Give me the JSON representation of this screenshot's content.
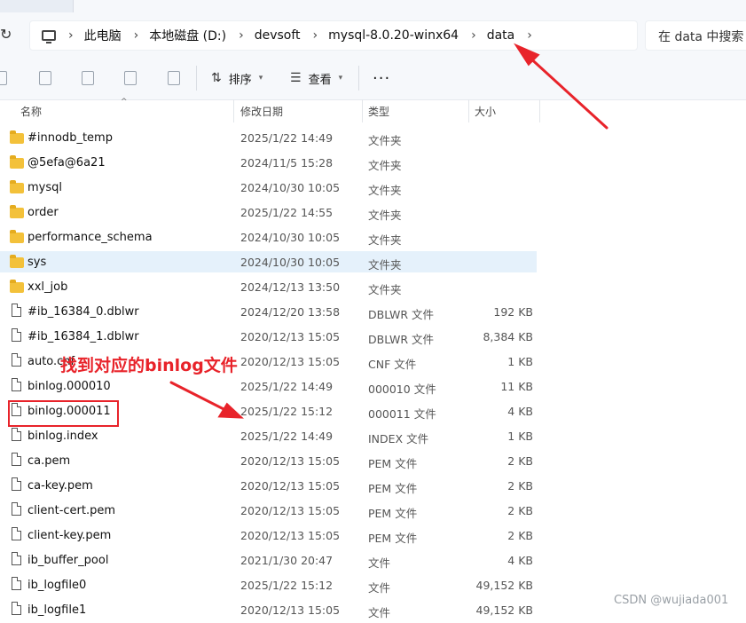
{
  "window": {
    "breadcrumb": [
      "此电脑",
      "本地磁盘 (D:)",
      "devsoft",
      "mysql-8.0.20-winx64",
      "data"
    ],
    "search_placeholder": "在 data 中搜索"
  },
  "toolbar": {
    "sort_label": "排序",
    "view_label": "查看",
    "more_label": "···"
  },
  "columns": {
    "name": "名称",
    "date": "修改日期",
    "type": "类型",
    "size": "大小"
  },
  "files": [
    {
      "name": "#innodb_temp",
      "date": "2025/1/22 14:49",
      "type": "文件夹",
      "size": "",
      "kind": "folder"
    },
    {
      "name": "@5efa@6a21",
      "date": "2024/11/5 15:28",
      "type": "文件夹",
      "size": "",
      "kind": "folder"
    },
    {
      "name": "mysql",
      "date": "2024/10/30 10:05",
      "type": "文件夹",
      "size": "",
      "kind": "folder"
    },
    {
      "name": "order",
      "date": "2025/1/22 14:55",
      "type": "文件夹",
      "size": "",
      "kind": "folder"
    },
    {
      "name": "performance_schema",
      "date": "2024/10/30 10:05",
      "type": "文件夹",
      "size": "",
      "kind": "folder"
    },
    {
      "name": "sys",
      "date": "2024/10/30 10:05",
      "type": "文件夹",
      "size": "",
      "kind": "folder",
      "selected": true
    },
    {
      "name": "xxl_job",
      "date": "2024/12/13 13:50",
      "type": "文件夹",
      "size": "",
      "kind": "folder"
    },
    {
      "name": "#ib_16384_0.dblwr",
      "date": "2024/12/20 13:58",
      "type": "DBLWR 文件",
      "size": "192 KB",
      "kind": "file"
    },
    {
      "name": "#ib_16384_1.dblwr",
      "date": "2020/12/13 15:05",
      "type": "DBLWR 文件",
      "size": "8,384 KB",
      "kind": "file"
    },
    {
      "name": "auto.cnf",
      "date": "2020/12/13 15:05",
      "type": "CNF 文件",
      "size": "1 KB",
      "kind": "file"
    },
    {
      "name": "binlog.000010",
      "date": "2025/1/22 14:49",
      "type": "000010 文件",
      "size": "11 KB",
      "kind": "file"
    },
    {
      "name": "binlog.000011",
      "date": "2025/1/22 15:12",
      "type": "000011 文件",
      "size": "4 KB",
      "kind": "file",
      "highlighted": true
    },
    {
      "name": "binlog.index",
      "date": "2025/1/22 14:49",
      "type": "INDEX 文件",
      "size": "1 KB",
      "kind": "file"
    },
    {
      "name": "ca.pem",
      "date": "2020/12/13 15:05",
      "type": "PEM 文件",
      "size": "2 KB",
      "kind": "file"
    },
    {
      "name": "ca-key.pem",
      "date": "2020/12/13 15:05",
      "type": "PEM 文件",
      "size": "2 KB",
      "kind": "file"
    },
    {
      "name": "client-cert.pem",
      "date": "2020/12/13 15:05",
      "type": "PEM 文件",
      "size": "2 KB",
      "kind": "file"
    },
    {
      "name": "client-key.pem",
      "date": "2020/12/13 15:05",
      "type": "PEM 文件",
      "size": "2 KB",
      "kind": "file"
    },
    {
      "name": "ib_buffer_pool",
      "date": "2021/1/30 20:47",
      "type": "文件",
      "size": "4 KB",
      "kind": "file"
    },
    {
      "name": "ib_logfile0",
      "date": "2025/1/22 15:12",
      "type": "文件",
      "size": "49,152 KB",
      "kind": "file"
    },
    {
      "name": "ib_logfile1",
      "date": "2020/12/13 15:05",
      "type": "文件",
      "size": "49,152 KB",
      "kind": "file"
    }
  ],
  "annotation": {
    "text": "找到对应的binlog文件",
    "color": "#e8232a"
  },
  "watermark": "CSDN @wujiada001"
}
